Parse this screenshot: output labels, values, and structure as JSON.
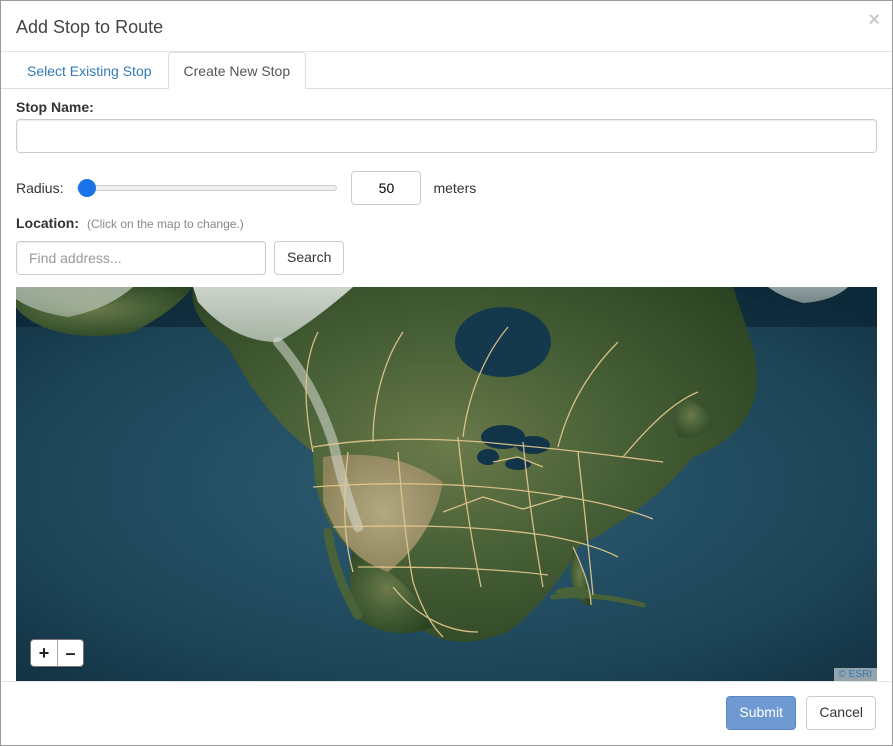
{
  "dialog": {
    "title": "Add Stop to Route"
  },
  "tabs": {
    "existing": "Select Existing Stop",
    "create": "Create New Stop"
  },
  "form": {
    "stopNameLabel": "Stop Name:",
    "stopNameValue": "",
    "radiusLabel": "Radius:",
    "radiusValue": "50",
    "radiusUnits": "meters",
    "locationLabel": "Location:",
    "locationHint": "(Click on the map to change.)",
    "searchPlaceholder": "Find address...",
    "searchValue": "",
    "searchButton": "Search"
  },
  "map": {
    "zoomIn": "+",
    "zoomOut": "–",
    "attribution": "© ESRI"
  },
  "footer": {
    "submit": "Submit",
    "cancel": "Cancel"
  }
}
